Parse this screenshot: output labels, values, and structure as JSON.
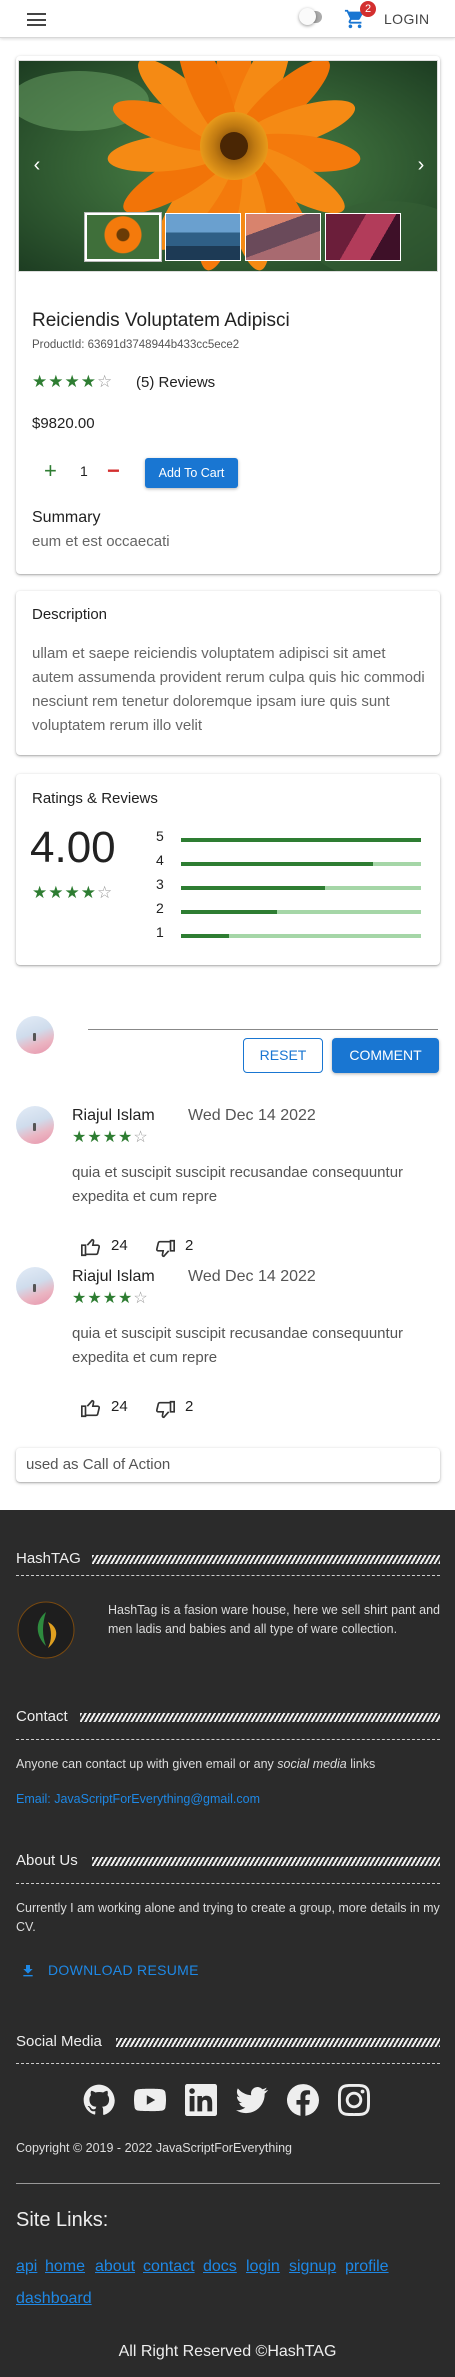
{
  "header": {
    "login_label": "LOGIN",
    "cart_count": "2"
  },
  "gallery": {
    "prev_arrow": "‹",
    "next_arrow": "›"
  },
  "product": {
    "title": "Reiciendis Voluptatem Adipisci",
    "product_id": "ProductId: 63691d3748944b433cc5ece2",
    "rating_stars": 4,
    "reviews_label": "(5) Reviews",
    "price": "$9820.00",
    "quantity": "1",
    "add_to_cart": "Add To Cart",
    "summary_heading": "Summary",
    "summary_text": "eum et est occaecati"
  },
  "description": {
    "heading": "Description",
    "text": "ullam et saepe reiciendis voluptatem adipisci sit amet autem assumenda provident rerum culpa quis hic commodi nesciunt rem tenetur doloremque ipsam iure quis sunt voluptatem rerum illo velit"
  },
  "ratings": {
    "heading": "Ratings & Reviews",
    "average": "4.00",
    "average_stars": 4,
    "bars": [
      {
        "label": "5",
        "fraction": 1.0
      },
      {
        "label": "4",
        "fraction": 0.8
      },
      {
        "label": "3",
        "fraction": 0.6
      },
      {
        "label": "2",
        "fraction": 0.4
      },
      {
        "label": "1",
        "fraction": 0.2
      }
    ]
  },
  "comment_form": {
    "reset_label": "RESET",
    "comment_label": "COMMENT"
  },
  "reviews": [
    {
      "name": "Riajul Islam",
      "date": "Wed Dec 14 2022",
      "stars": 4,
      "text": "quia et suscipit suscipit recusandae consequuntur expedita et cum repre",
      "likes": "24",
      "dislikes": "2"
    },
    {
      "name": "Riajul Islam",
      "date": "Wed Dec 14 2022",
      "stars": 4,
      "text": "quia et suscipit suscipit recusandae consequuntur expedita et cum repre",
      "likes": "24",
      "dislikes": "2"
    }
  ],
  "cta": {
    "text": "used as Call of Action"
  },
  "footer": {
    "brand_heading": "HashTAG",
    "brand_text": "HashTag is a fasion ware house, here we sell shirt pant and men ladis and babies and all type of ware collection.",
    "contact_heading": "Contact",
    "contact_text_prefix": "Anyone can contact up with given email or any ",
    "contact_text_em": "social media",
    "contact_text_suffix": " links",
    "email": "Email: JavaScriptForEverything@gmail.com",
    "about_heading": "About Us",
    "about_text": "Currently I am working alone and trying to create a group, more details in my CV.",
    "download_label": "DOWNLOAD RESUME",
    "social_heading": "Social Media",
    "social_icons": [
      "github-icon",
      "youtube-icon",
      "linkedin-icon",
      "twitter-icon",
      "facebook-icon",
      "instagram-icon"
    ],
    "copyright": "Copyright © 2019 - 2022 JavaScriptForEverything",
    "site_links_heading": "Site Links:",
    "site_links": [
      "api",
      "home",
      "about",
      "contact",
      "docs",
      "login",
      "signup",
      "profile",
      "dashboard"
    ],
    "rights": "All Right Reserved ©HashTAG"
  },
  "colors": {
    "primary": "#1976d2",
    "star": "#2e7d32",
    "danger": "#d32f2f",
    "footer_bg": "#2b2b2b"
  }
}
